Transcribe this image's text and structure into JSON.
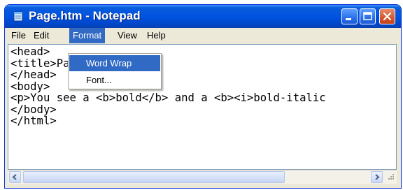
{
  "window": {
    "title": "Page.htm - Notepad"
  },
  "menubar": {
    "file": "File",
    "edit": "Edit",
    "format": "Format",
    "view": "View",
    "help": "Help"
  },
  "format_menu": {
    "word_wrap": "Word Wrap",
    "font": "Font..."
  },
  "editor": {
    "lines": [
      "<head>",
      "<title>Page</title>",
      "</head>",
      "<body>",
      "<p>You see a <b>bold</b> and a <b><i>bold-italic",
      "</body>",
      "</html>"
    ]
  },
  "icons": [
    "notepad-app-icon",
    "minimize-icon",
    "maximize-icon",
    "close-icon",
    "scroll-left-icon",
    "scroll-right-icon",
    "size-grip-icon"
  ],
  "colors": {
    "titlebar": "#0053e0",
    "menu_highlight": "#316ac5",
    "close_button": "#d4562d"
  }
}
